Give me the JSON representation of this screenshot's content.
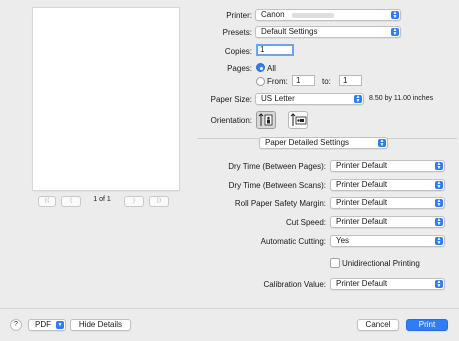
{
  "preview": {
    "page_indicator": "1 of 1",
    "first_page": "⟨⟨",
    "prev_page": "⟨",
    "next_page": "⟩",
    "last_page": "⟩⟩"
  },
  "printer": {
    "label": "Printer:",
    "value": "Canon"
  },
  "presets": {
    "label": "Presets:",
    "value": "Default Settings"
  },
  "copies": {
    "label": "Copies:",
    "value": "1"
  },
  "pages": {
    "label": "Pages:",
    "all_label": "All",
    "from_label": "From:",
    "from_value": "1",
    "to_label": "to:",
    "to_value": "1"
  },
  "paper_size": {
    "label": "Paper Size:",
    "value": "US Letter",
    "dimensions": "8.50 by 11.00 inches"
  },
  "orientation": {
    "label": "Orientation:"
  },
  "section": {
    "value": "Paper Detailed Settings"
  },
  "settings": [
    {
      "label": "Dry Time (Between Pages):",
      "value": "Printer Default"
    },
    {
      "label": "Dry Time (Between Scans):",
      "value": "Printer Default"
    },
    {
      "label": "Roll Paper Safety Margin:",
      "value": "Printer Default"
    },
    {
      "label": "Cut Speed:",
      "value": "Printer Default"
    },
    {
      "label": "Automatic Cutting:",
      "value": "Yes"
    }
  ],
  "unidirectional": {
    "label": "Unidirectional Printing",
    "checked": false
  },
  "calibration": {
    "label": "Calibration Value:",
    "value": "Printer Default"
  },
  "footer": {
    "help": "?",
    "pdf": "PDF",
    "hide_details": "Hide Details",
    "cancel": "Cancel",
    "print": "Print"
  },
  "colors": {
    "accent": "#2f7df6",
    "background": "#ececec"
  }
}
